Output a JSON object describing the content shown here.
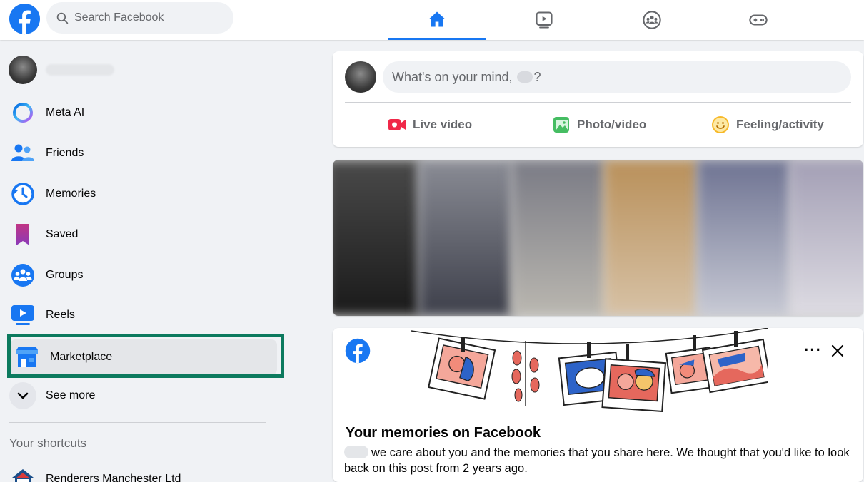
{
  "colors": {
    "brand": "#1877f2",
    "highlight_box": "#0c7a5e",
    "live_video": "#f02849",
    "photo_video": "#45bd62",
    "feeling": "#f7b928"
  },
  "header": {
    "search": {
      "placeholder": "Search Facebook"
    },
    "tabs": [
      {
        "icon": "home-icon",
        "active": true
      },
      {
        "icon": "video-icon",
        "active": false
      },
      {
        "icon": "groups-icon",
        "active": false
      },
      {
        "icon": "gaming-icon",
        "active": false
      }
    ]
  },
  "sidebar": {
    "items": [
      {
        "label": "",
        "icon": "avatar"
      },
      {
        "label": "Meta AI",
        "icon": "meta-ai-icon"
      },
      {
        "label": "Friends",
        "icon": "friends-icon"
      },
      {
        "label": "Memories",
        "icon": "memories-icon"
      },
      {
        "label": "Saved",
        "icon": "saved-icon"
      },
      {
        "label": "Groups",
        "icon": "groups-icon"
      },
      {
        "label": "Reels",
        "icon": "reels-icon"
      },
      {
        "label": "Marketplace",
        "icon": "marketplace-icon"
      },
      {
        "label": "See more",
        "icon": "chevron-down-icon"
      }
    ],
    "shortcuts_title": "Your shortcuts",
    "shortcuts": [
      {
        "label": "Renderers Manchester Ltd",
        "icon": "house-icon"
      }
    ]
  },
  "composer": {
    "prompt_prefix": "What's on your mind,",
    "prompt_suffix": "?",
    "actions": [
      {
        "label": "Live video",
        "icon": "live-video-icon"
      },
      {
        "label": "Photo/video",
        "icon": "photo-icon"
      },
      {
        "label": "Feeling/activity",
        "icon": "smiley-icon"
      }
    ]
  },
  "memory": {
    "more_label": "···",
    "title": "Your memories on Facebook",
    "body": "we care about you and the memories that you share here. We thought that you'd like to look back on this post from 2 years ago."
  }
}
